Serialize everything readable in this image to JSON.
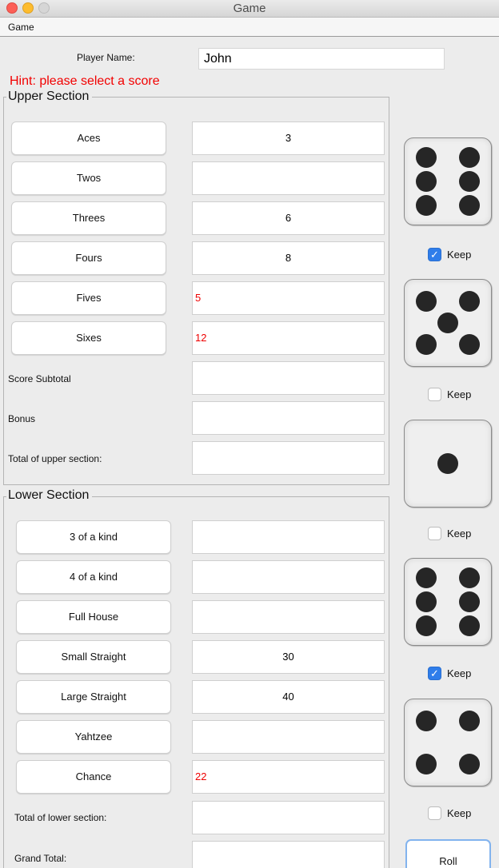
{
  "window": {
    "title": "Game"
  },
  "menu": {
    "game": "Game"
  },
  "player": {
    "label": "Player Name:",
    "value": "John"
  },
  "hint": "Hint:  please select a score",
  "upper": {
    "title": "Upper Section",
    "rows": [
      {
        "label": "Aces",
        "score": "3",
        "state": "scored"
      },
      {
        "label": "Twos",
        "score": "",
        "state": "empty"
      },
      {
        "label": "Threes",
        "score": "6",
        "state": "scored"
      },
      {
        "label": "Fours",
        "score": "8",
        "state": "scored"
      },
      {
        "label": "Fives",
        "score": "5",
        "state": "potential"
      },
      {
        "label": "Sixes",
        "score": "12",
        "state": "potential"
      }
    ],
    "subtotal_label": "Score Subtotal",
    "bonus_label": "Bonus",
    "total_label": "Total of upper section:"
  },
  "lower": {
    "title": "Lower Section",
    "rows": [
      {
        "label": "3 of a kind",
        "score": "",
        "state": "empty"
      },
      {
        "label": "4 of a kind",
        "score": "",
        "state": "empty"
      },
      {
        "label": "Full House",
        "score": "",
        "state": "empty"
      },
      {
        "label": "Small Straight",
        "score": "30",
        "state": "scored"
      },
      {
        "label": "Large Straight",
        "score": "40",
        "state": "scored"
      },
      {
        "label": "Yahtzee",
        "score": "",
        "state": "empty"
      },
      {
        "label": "Chance",
        "score": "22",
        "state": "potential"
      }
    ],
    "total_label": "Total of lower section:",
    "grand_total_label": "Grand Total:"
  },
  "dice": [
    {
      "value": 6,
      "kept": true
    },
    {
      "value": 5,
      "kept": false
    },
    {
      "value": 1,
      "kept": false
    },
    {
      "value": 6,
      "kept": true
    },
    {
      "value": 4,
      "kept": false
    }
  ],
  "keep_label": "Keep",
  "roll_label": "Roll",
  "colors": {
    "potential_score": "#ee0000",
    "hint": "#f20000",
    "checkbox_checked": "#2f7dea"
  }
}
